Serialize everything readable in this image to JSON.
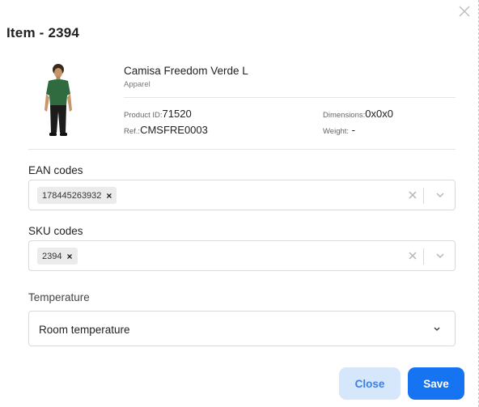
{
  "modal": {
    "title": "Item - 2394"
  },
  "product": {
    "name": "Camisa Freedom Verde L",
    "category": "Apparel",
    "product_id_label": "Product ID:",
    "product_id": "71520",
    "ref_label": "Ref.:",
    "ref": "CMSFRE0003",
    "dimensions_label": "Dimensions:",
    "dimensions": "0x0x0",
    "weight_label": "Weight:",
    "weight": "-"
  },
  "ean": {
    "label": "EAN codes",
    "chips": [
      "178445263932"
    ]
  },
  "sku": {
    "label": "SKU codes",
    "chips": [
      "2394"
    ]
  },
  "temperature": {
    "label": "Temperature",
    "selected": "Room temperature"
  },
  "buttons": {
    "close": "Close",
    "save": "Save"
  },
  "icons": {
    "chip_remove": "×"
  },
  "colors": {
    "primary": "#1673f2",
    "secondary_bg": "#d6e6fb",
    "secondary_text": "#3f7fe0"
  }
}
